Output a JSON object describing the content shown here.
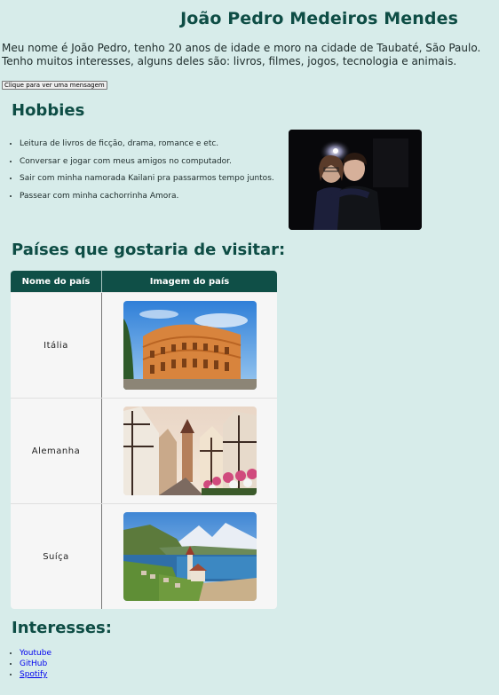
{
  "header": {
    "title": "João Pedro Medeiros Mendes"
  },
  "intro": {
    "line1": "Meu nome é João Pedro, tenho 20 anos de idade e moro na cidade de Taubaté, São Paulo.",
    "line2": "Tenho muitos interesses, alguns deles são: livros, filmes, jogos, tecnologia e animais."
  },
  "message_button": {
    "label": "Clique para ver uma mensagem"
  },
  "hobbies": {
    "title": "Hobbies",
    "items": [
      "Leitura de livros de ficção, drama, romance e etc.",
      "Conversar e jogar com meus amigos no computador.",
      "Sair com minha namorada Kailani pra passarmos tempo juntos.",
      "Passear com minha cachorrinha Amora."
    ],
    "photo_icon": "couple-photo"
  },
  "countries": {
    "title": "Países que gostaria de visitar:",
    "headers": [
      "Nome do país",
      "Imagem do país"
    ],
    "rows": [
      {
        "name": "Itália",
        "image": "colosseum-image"
      },
      {
        "name": "Alemanha",
        "image": "german-street-image"
      },
      {
        "name": "Suíça",
        "image": "swiss-lake-image"
      }
    ]
  },
  "interests": {
    "title": "Interesses:",
    "links": [
      "Youtube",
      "GitHub",
      "Spotify"
    ]
  },
  "colors": {
    "background": "#d7ecea",
    "heading": "#0e4d45",
    "table_header": "#0f4f47",
    "link": "#0000ee"
  }
}
